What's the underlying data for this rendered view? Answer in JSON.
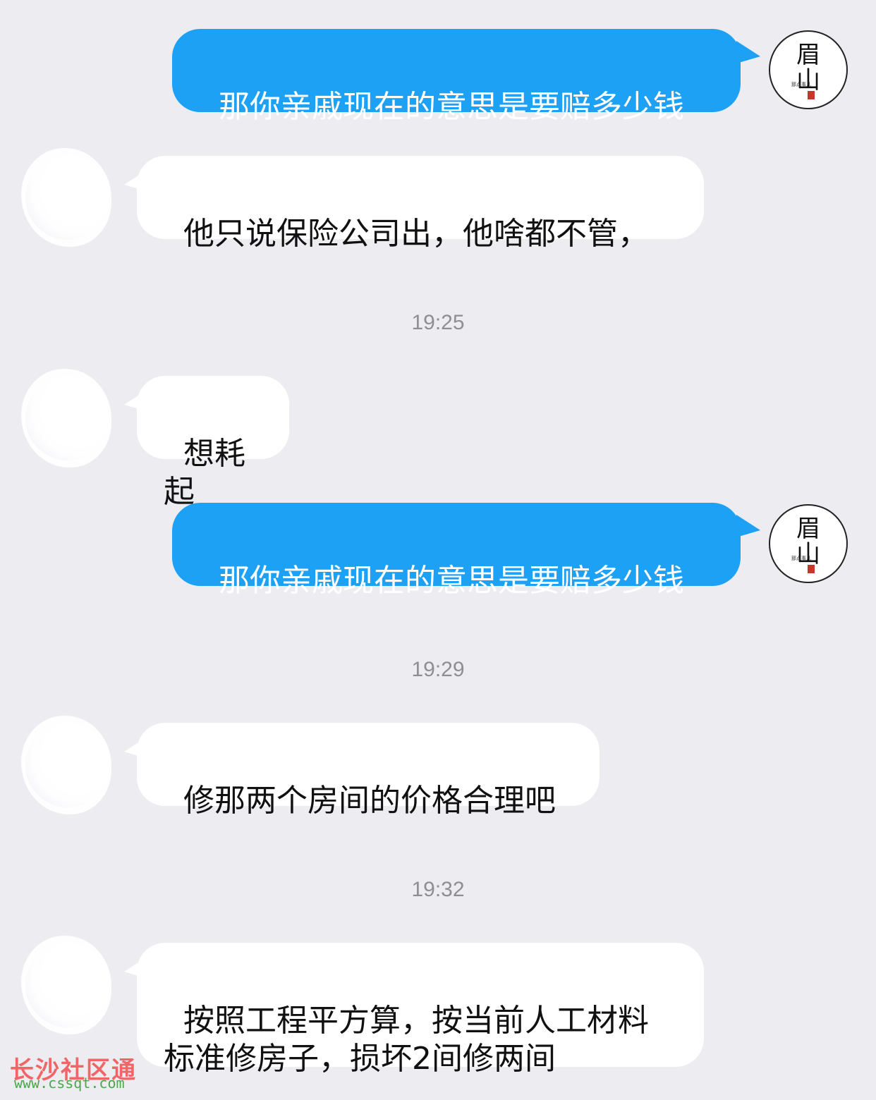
{
  "messages": [
    {
      "side": "out",
      "text": "那你亲戚现在的意思是要赔多少钱"
    },
    {
      "side": "in",
      "text": "他只说保险公司出，他啥都不管，"
    },
    {
      "timestamp": "19:25"
    },
    {
      "side": "in",
      "text": "想耗起"
    },
    {
      "side": "out",
      "text": "那你亲戚现在的意思是要赔多少钱"
    },
    {
      "timestamp": "19:29"
    },
    {
      "side": "in",
      "text": "修那两个房间的价格合理吧"
    },
    {
      "timestamp": "19:32"
    },
    {
      "side": "in",
      "text": "按照工程平方算，按当前人工材料\n标准修房子，损坏2间修两间"
    }
  ],
  "self_avatar": {
    "line1": "眉",
    "line2": "山",
    "small_text": "那点事儿"
  },
  "watermark": {
    "text": "长沙社区通",
    "url": "www.cssqt.com"
  },
  "colors": {
    "background": "#ececf1",
    "outgoing_bubble": "#1da1f4",
    "incoming_bubble": "#ffffff",
    "timestamp": "#8e8e93"
  }
}
